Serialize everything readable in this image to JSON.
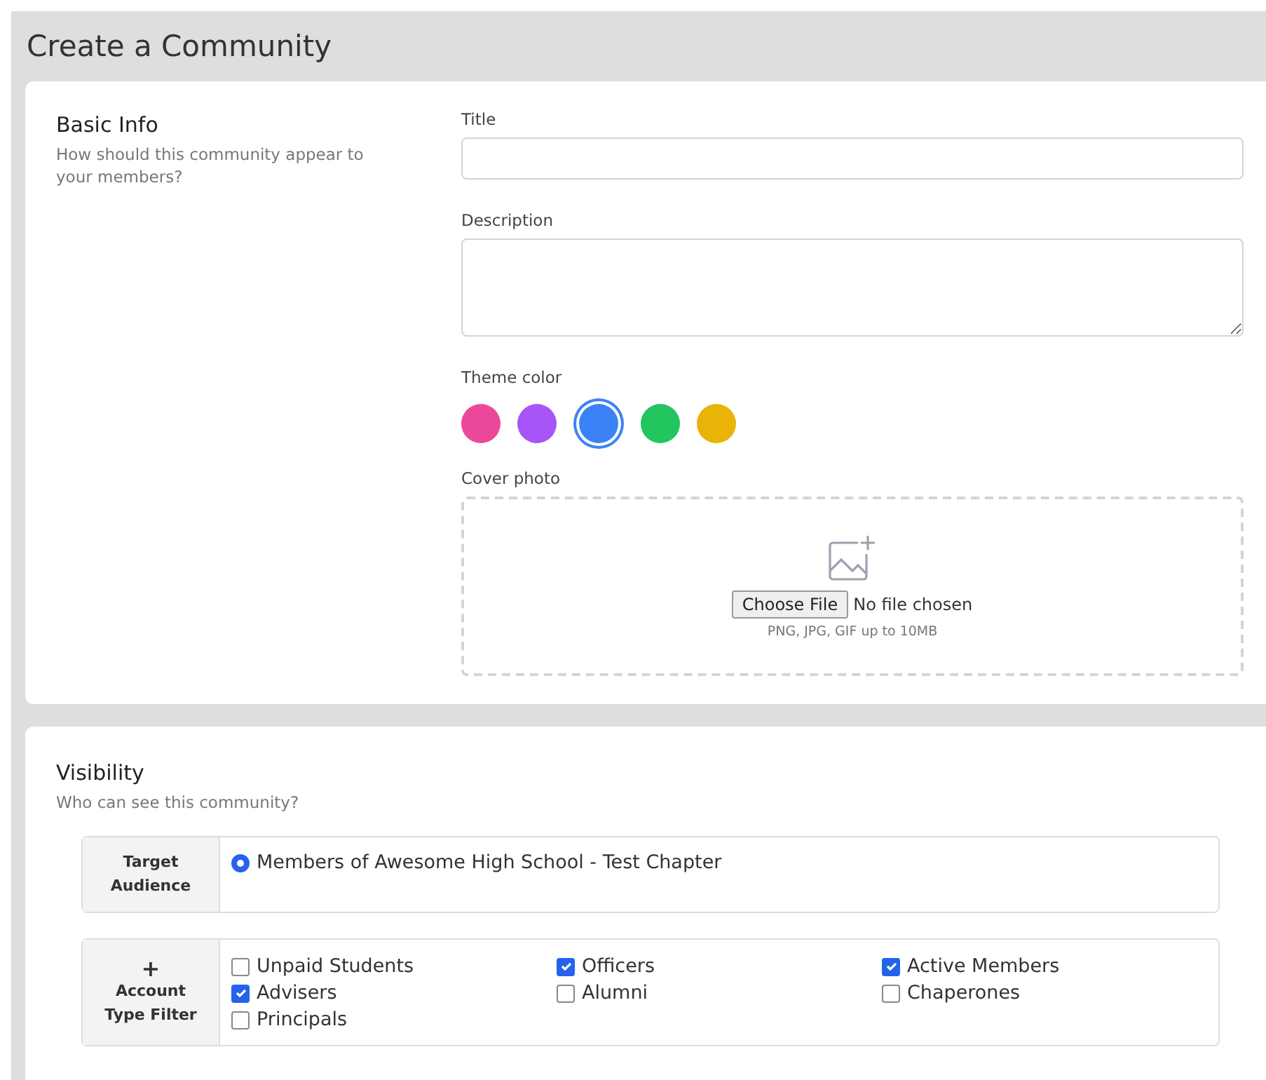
{
  "page": {
    "title": "Create a Community"
  },
  "basic_info": {
    "heading": "Basic Info",
    "subtitle": "How should this community appear to your members?",
    "title_field": {
      "label": "Title"
    },
    "description_field": {
      "label": "Description"
    },
    "theme_color": {
      "label": "Theme color",
      "options": [
        {
          "color": "#ec4899",
          "selected": false
        },
        {
          "color": "#a855f7",
          "selected": false
        },
        {
          "color": "#3b82f6",
          "selected": true
        },
        {
          "color": "#22c55e",
          "selected": false
        },
        {
          "color": "#eab308",
          "selected": false
        }
      ]
    },
    "cover_photo": {
      "label": "Cover photo",
      "button": "Choose File",
      "status": "No file chosen",
      "hint": "PNG, JPG, GIF up to 10MB"
    }
  },
  "visibility": {
    "heading": "Visibility",
    "subtitle": "Who can see this community?",
    "target_audience": {
      "label": "Target Audience",
      "options": [
        {
          "label": "Members of Awesome High School - Test Chapter",
          "selected": true
        }
      ]
    },
    "account_type_filter": {
      "icon": "+",
      "label": "Account Type Filter",
      "columns": [
        [
          {
            "label": "Unpaid Students",
            "checked": false
          },
          {
            "label": "Advisers",
            "checked": true
          },
          {
            "label": "Principals",
            "checked": false
          }
        ],
        [
          {
            "label": "Officers",
            "checked": true
          },
          {
            "label": "Alumni",
            "checked": false
          }
        ],
        [
          {
            "label": "Active Members",
            "checked": true
          },
          {
            "label": "Chaperones",
            "checked": false
          }
        ]
      ]
    }
  }
}
